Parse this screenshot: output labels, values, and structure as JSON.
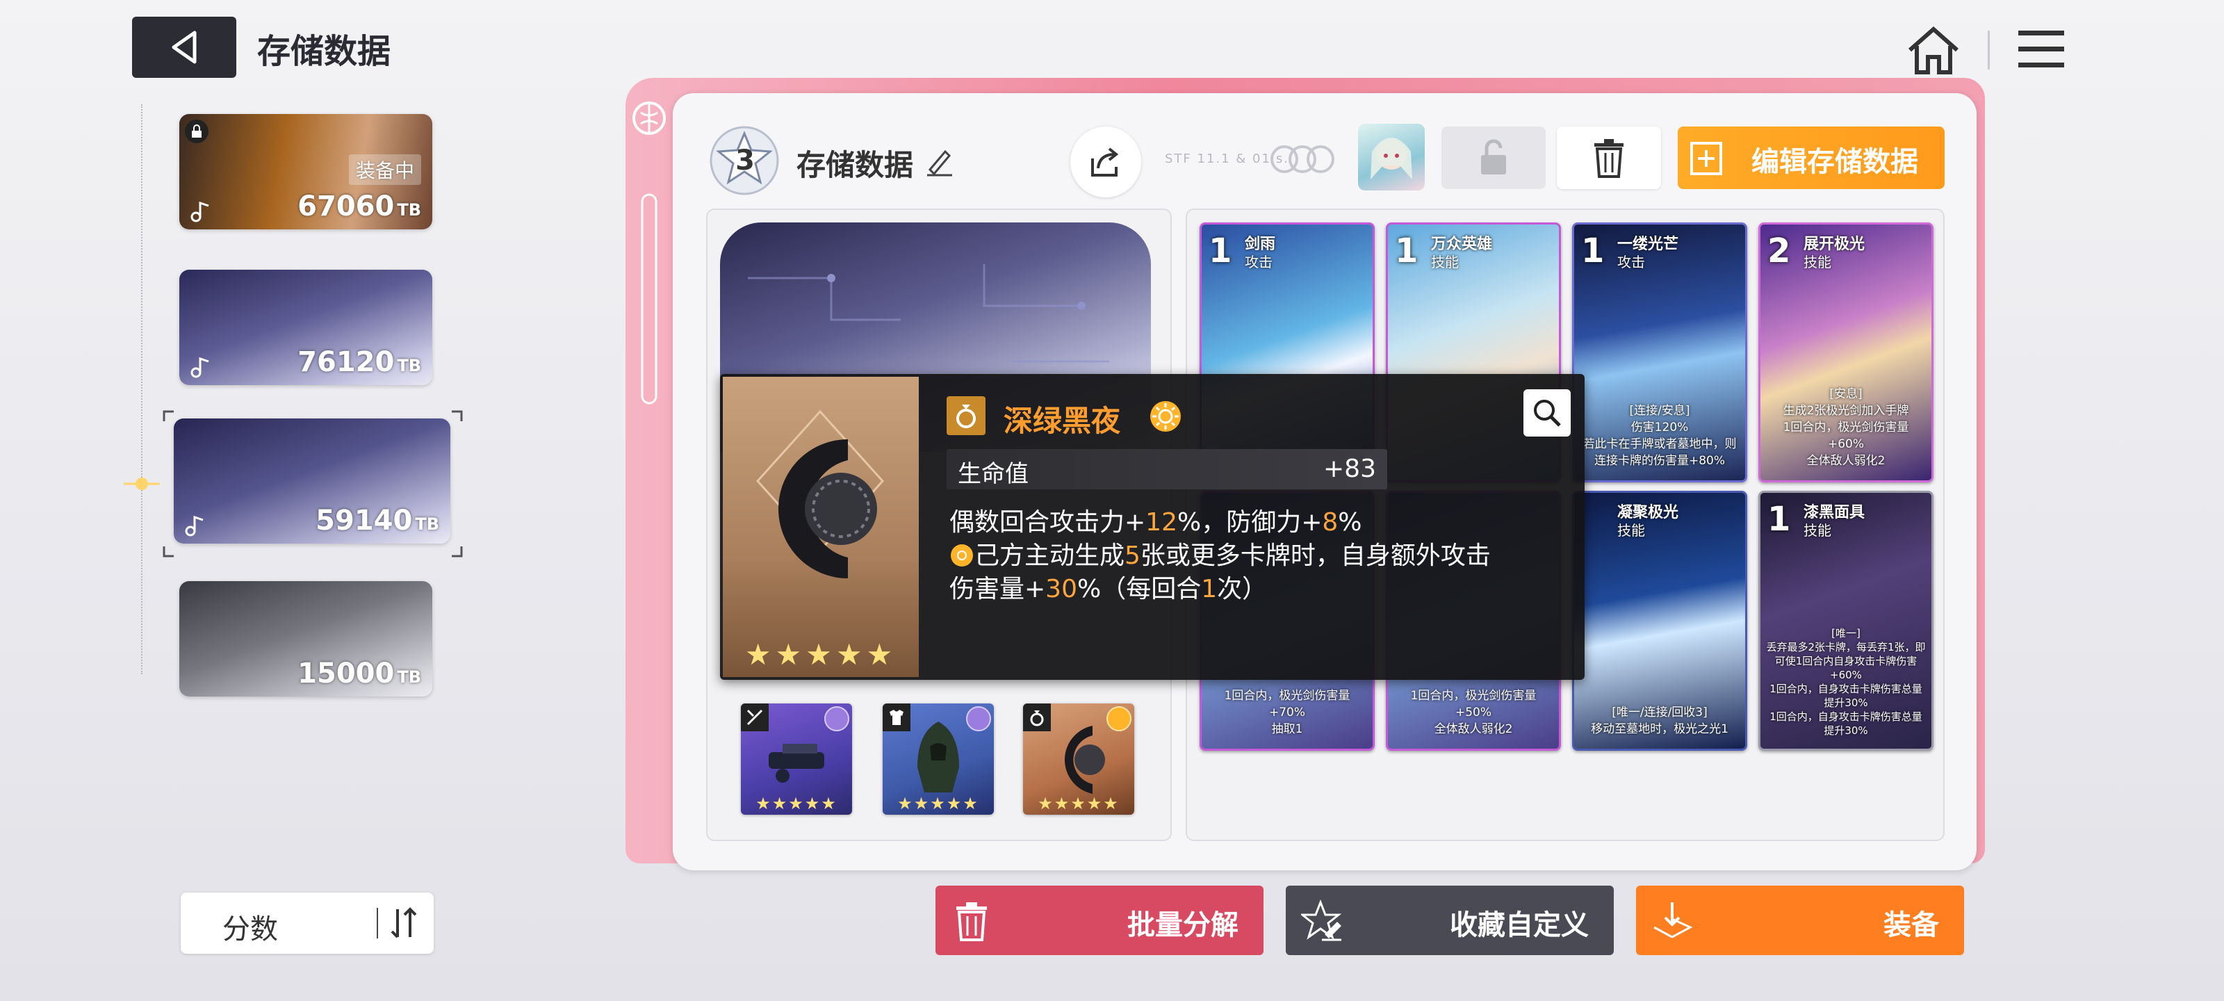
{
  "header": {
    "title": "存储数据",
    "back_icon": "back-arrow-icon",
    "home_icon": "home-icon",
    "menu_icon": "hamburger-menu-icon"
  },
  "save_list": {
    "items": [
      {
        "score": "67060",
        "unit": "TB",
        "equipped_label": "装备中",
        "locked": true,
        "selected": false
      },
      {
        "score": "76120",
        "unit": "TB",
        "equipped_label": "",
        "locked": false,
        "selected": false
      },
      {
        "score": "59140",
        "unit": "TB",
        "equipped_label": "",
        "locked": false,
        "selected": true
      },
      {
        "score": "15000",
        "unit": "TB",
        "equipped_label": "",
        "locked": false,
        "selected": false
      }
    ],
    "sort_label": "分数"
  },
  "detail": {
    "level": "3",
    "name": "存储数据",
    "faint_text": "STF 11.1 & 01's.",
    "edit_button": "编辑存储数据"
  },
  "tooltip": {
    "item_name": "深绿黑夜",
    "stars": "★★★★★",
    "stat_label": "生命值",
    "stat_value": "+83",
    "line1_a": "偶数回合攻击力+",
    "line1_b": "12",
    "line1_c": "%，防御力+",
    "line1_d": "8",
    "line1_e": "%",
    "line2_a": "己方主动生成",
    "line2_b": "5",
    "line2_c": "张或更多卡牌时，自身额外攻击",
    "line3_a": "伤害量+",
    "line3_b": "30",
    "line3_c": "%（每回合",
    "line3_d": "1",
    "line3_e": "次）"
  },
  "equipment_slots": [
    {
      "type_icon": "sword-icon",
      "stars": "★★★★★",
      "accent": "#8b6ad8"
    },
    {
      "type_icon": "armor-icon",
      "stars": "★★★★★",
      "accent": "#8b6ad8"
    },
    {
      "type_icon": "ring-icon",
      "stars": "★★★★★",
      "accent": "#ffb42a"
    }
  ],
  "cards": [
    {
      "cost": "1",
      "name": "剑雨",
      "type": "攻击",
      "desc": ""
    },
    {
      "cost": "1",
      "name": "万众英雄",
      "type": "技能",
      "desc": ""
    },
    {
      "cost": "1",
      "name": "一缕光芒",
      "type": "攻击",
      "desc": "[连接/安息]\n伤害120%\n若此卡在手牌或者墓地中，则连接卡牌的伤害量+80%"
    },
    {
      "cost": "2",
      "name": "展开极光",
      "type": "技能",
      "desc": "[安息]\n生成2张极光剑加入手牌\n1回合内，极光剑伤害量+60%\n全体敌人弱化2"
    },
    {
      "cost": "",
      "name": "",
      "type": "",
      "desc": "1回合内，极光剑伤害量+70%\n抽取1"
    },
    {
      "cost": "",
      "name": "",
      "type": "",
      "desc": "1回合内，极光剑伤害量+50%\n全体敌人弱化2"
    },
    {
      "cost": "",
      "name": "凝聚极光",
      "type": "技能",
      "desc": "[唯一/连接/回收3]\n移动至墓地时，极光之光1"
    },
    {
      "cost": "1",
      "name": "漆黑面具",
      "type": "技能",
      "desc": "[唯一]\n丢弃最多2张卡牌，每丢弃1张，即可使1回合内自身攻击卡牌伤害+60%\n1回合内，自身攻击卡牌伤害总量提升30%\n1回合内，自身攻击卡牌伤害总量提升30%"
    }
  ],
  "bottom_buttons": {
    "bulk_decompose": "批量分解",
    "favorite_custom": "收藏自定义",
    "equip": "装备"
  },
  "colors": {
    "accent_orange": "#ff9b1c",
    "pink_frame": "#f0879c",
    "bulk_red": "#d84a62",
    "dark_button": "#4a4a54",
    "equip_orange": "#ff7e1f"
  }
}
